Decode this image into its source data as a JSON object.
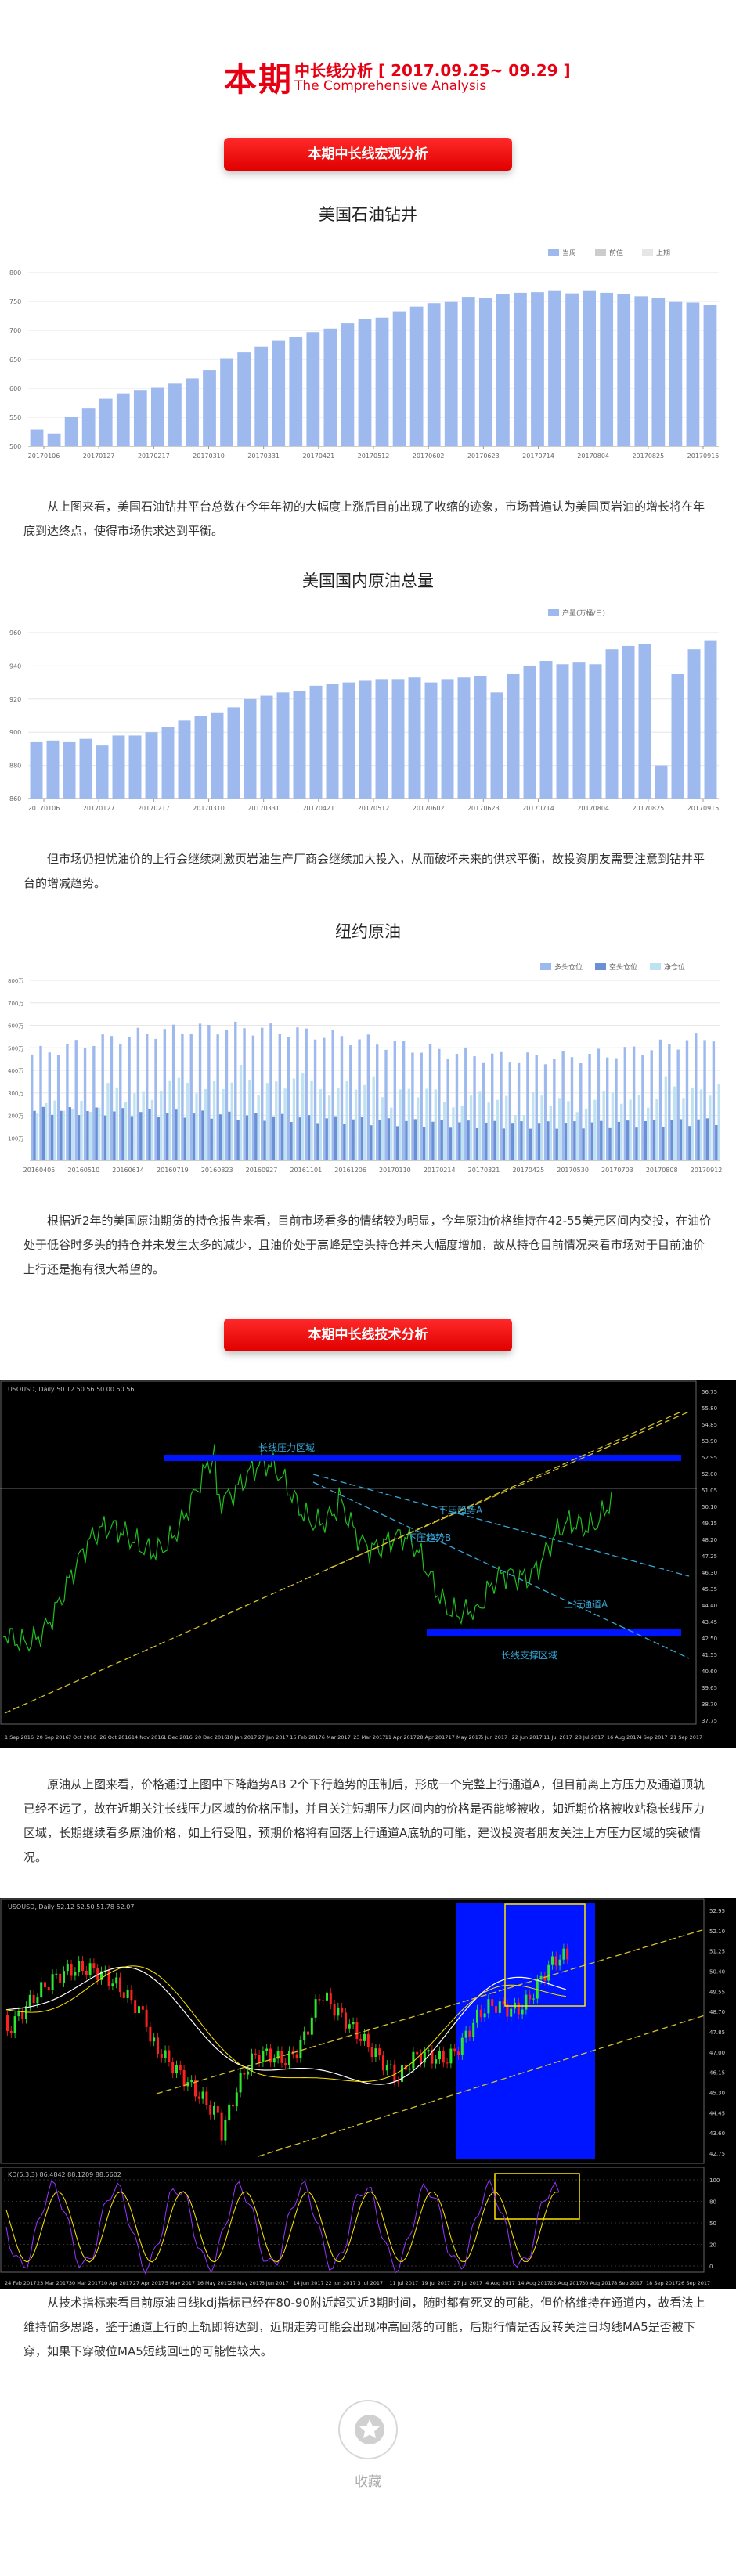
{
  "header": {
    "big": "本期",
    "line1": "中长线分析 [ 2017.09.25~ 09.29 ]",
    "line2": "The Comprehensive Analysis"
  },
  "sections": {
    "macro": "本期中长线宏观分析",
    "tech": "本期中长线技术分析"
  },
  "paragraphs": {
    "p1": "从上图来看，美国石油钻井平台总数在今年年初的大幅度上涨后目前出现了收缩的迹象，市场普遍认为美国页岩油的增长将在年底到达终点，使得市场供求达到平衡。",
    "p2": "但市场仍担忧油价的上行会继续刺激页岩油生产厂商会继续加大投入，从而破坏未来的供求平衡，故投资朋友需要注意到钻井平台的增减趋势。",
    "p3": "根据近2年的美国原油期货的持仓报告来看，目前市场看多的情绪较为明显，今年原油价格维持在42-55美元区间内交投，在油价处于低谷时多头的持仓并未发生太多的减少，且油价处于高峰是空头持仓并未大幅度增加，故从持仓目前情况来看市场对于目前油价上行还是抱有很大希望的。",
    "p4": "原油从上图来看，价格通过上图中下降趋势AB  2个下行趋势的压制后，形成一个完整上行通道A，但目前离上方压力及通道顶轨已经不远了，故在近期关注长线压力区域的价格压制，并且关注短期压力区间内的价格是否能够被收，如近期价格被收站稳长线压力区域，长期继续看多原油价格，如上行受阻，预期价格将有回落上行通道A底轨的可能，建议投资者朋友关注上方压力区域的突破情况。",
    "p5": "从技术指标来看目前原油日线kdj指标已经在80-90附近超买近3期时间，随时都有死叉的可能，但价格维持在通道内，故看法上维持偏多思路，鉴于通道上行的上轨即将达到，近期走势可能会出现冲高回落的可能，后期行情是否反转关注日均线MA5是否被下穿，如果下穿破位MA5短线回吐的可能性较大。"
  },
  "chart_data": [
    {
      "type": "bar",
      "title": "美国石油钻井",
      "legend": [
        "当周",
        "前值",
        "上期"
      ],
      "x_tick_labels": [
        "20170106",
        "20170127",
        "20170217",
        "20170310",
        "20170331",
        "20170421",
        "20170512",
        "20170602",
        "20170623",
        "20170714",
        "20170804",
        "20170825",
        "20170915"
      ],
      "y_ticks": [
        500,
        550,
        600,
        650,
        700,
        750,
        800
      ],
      "ylim": [
        500,
        800
      ],
      "values": [
        529,
        522,
        551,
        566,
        583,
        591,
        597,
        602,
        609,
        617,
        631,
        652,
        662,
        672,
        683,
        688,
        697,
        703,
        712,
        720,
        722,
        733,
        741,
        747,
        749,
        758,
        756,
        763,
        765,
        766,
        768,
        764,
        768,
        765,
        763,
        759,
        756,
        749,
        748,
        744
      ]
    },
    {
      "type": "bar",
      "title": "美国国内原油总量",
      "legend": [
        "产量(万桶/日)"
      ],
      "x_tick_labels": [
        "20170106",
        "20170127",
        "20170217",
        "20170310",
        "20170331",
        "20170421",
        "20170512",
        "20170602",
        "20170623",
        "20170714",
        "20170804",
        "20170825",
        "20170915"
      ],
      "y_ticks": [
        860,
        880,
        900,
        920,
        940,
        960
      ],
      "ylim": [
        860,
        960
      ],
      "values": [
        894,
        895,
        894,
        896,
        892,
        898,
        898,
        900,
        903,
        907,
        910,
        912,
        915,
        920,
        922,
        924,
        925,
        928,
        929,
        930,
        931,
        932,
        932,
        933,
        930,
        932,
        933,
        934,
        924,
        935,
        940,
        943,
        941,
        942,
        941,
        950,
        952,
        953,
        880,
        935,
        950,
        955
      ]
    },
    {
      "type": "bar",
      "title": "纽约原油",
      "legend": [
        "多头仓位",
        "空头仓位",
        "净仓位"
      ],
      "x_tick_labels": [
        "20160405",
        "20160510",
        "20160614",
        "20160719",
        "20160823",
        "20160927",
        "20161101",
        "20161206",
        "20170110",
        "20170214",
        "20170321",
        "20170425",
        "20170530",
        "20170703",
        "20170808",
        "20170912"
      ],
      "y_ticks": [
        "100万",
        "200万",
        "300万",
        "400万",
        "500万",
        "600万",
        "700万",
        "800万"
      ],
      "ylim": [
        0,
        800
      ]
    }
  ],
  "tech_chart1": {
    "header": "USOUSD, Daily  50.12 50.56 50.00 50.56",
    "labels": {
      "resistance": "长线压力区域",
      "trend_a": "下压趋势A",
      "trend_b": "下压趋势B",
      "channel_a": "上行通道A",
      "support": "长线支撑区域"
    },
    "x_labels": [
      "1 Sep 2016",
      "20 Sep 2016",
      "7 Oct 2016",
      "26 Oct 2016",
      "14 Nov 2016",
      "1 Dec 2016",
      "20 Dec 2016",
      "10 Jan 2017",
      "27 Jan 2017",
      "15 Feb 2017",
      "6 Mar 2017",
      "23 Mar 2017",
      "11 Apr 2017",
      "28 Apr 2017",
      "17 May 2017",
      "5 Jun 2017",
      "22 Jun 2017",
      "11 Jul 2017",
      "28 Jul 2017",
      "16 Aug 2017",
      "4 Sep 2017",
      "21 Sep 2017"
    ],
    "y_labels": [
      "56.75",
      "55.80",
      "54.85",
      "53.90",
      "52.95",
      "52.00",
      "51.05",
      "50.10",
      "49.15",
      "48.20",
      "47.25",
      "46.30",
      "45.35",
      "44.40",
      "43.45",
      "42.50",
      "41.55",
      "40.60",
      "39.65",
      "38.70",
      "37.75"
    ]
  },
  "tech_chart2": {
    "header": "USOUSD, Daily  52.12 52.50 51.78 52.07",
    "sub_header": "KD(5,3,3) 86.4842 88.1209 88.5602",
    "x_labels": [
      "24 Feb 2017",
      "23 Mar 2017",
      "30 Mar 2017",
      "10 Apr 2017",
      "27 Apr 2017",
      "5 May 2017",
      "16 May 2017",
      "26 May 2017",
      "6 Jun 2017",
      "14 Jun 2017",
      "22 Jun 2017",
      "3 Jul 2017",
      "11 Jul 2017",
      "19 Jul 2017",
      "27 Jul 2017",
      "4 Aug 2017",
      "14 Aug 2017",
      "22 Aug 2017",
      "30 Aug 2017",
      "8 Sep 2017",
      "18 Sep 2017",
      "26 Sep 2017"
    ],
    "y_labels": [
      "52.95",
      "52.10",
      "51.25",
      "50.40",
      "49.55",
      "48.70",
      "47.85",
      "47.00",
      "46.15",
      "45.30",
      "44.45",
      "43.60",
      "42.75"
    ],
    "kd_levels": [
      "100",
      "80",
      "50",
      "20",
      "0"
    ]
  },
  "favorite": {
    "label": "收藏"
  },
  "colors": {
    "accent": "#e60012",
    "bar_blue": "#9db9ee",
    "bar_light": "#bfe2f2",
    "bar_dark": "#6d8fd6"
  }
}
